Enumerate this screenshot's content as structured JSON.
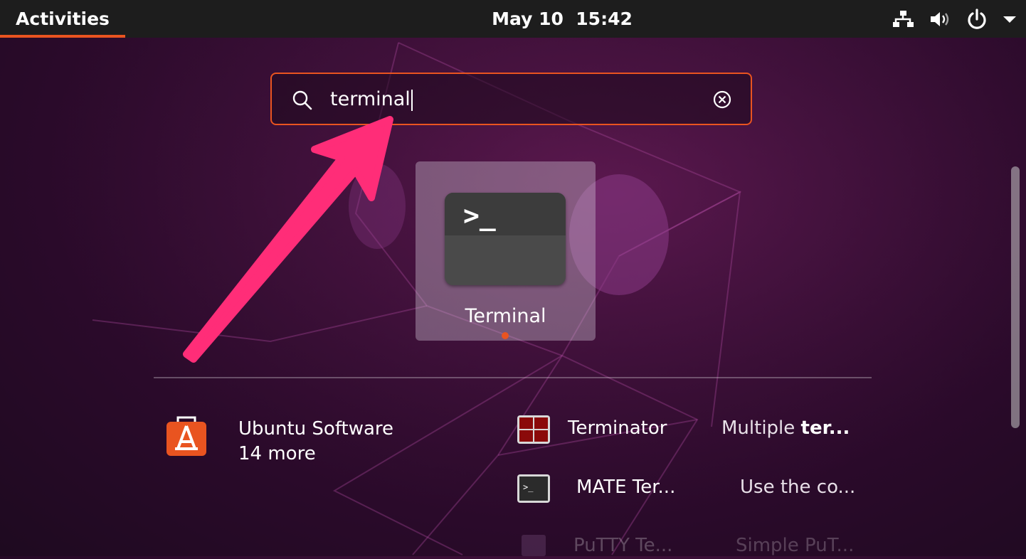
{
  "topbar": {
    "activities_label": "Activities",
    "clock": "May 10  15:42",
    "icons": [
      "network-icon",
      "volume-icon",
      "power-icon",
      "menu-arrow-icon"
    ]
  },
  "search": {
    "query": "terminal",
    "icons": [
      "search-icon",
      "clear-icon"
    ]
  },
  "apps": [
    {
      "label": "Terminal",
      "icon": "terminal-icon",
      "running": true
    }
  ],
  "provider": {
    "name": "Ubuntu Software",
    "more": "14 more",
    "icon": "ubuntu-software-icon"
  },
  "results": [
    {
      "name": "Terminator",
      "desc_plain": "Multiple ",
      "desc_bold": "ter...",
      "icon": "terminator-icon"
    },
    {
      "name": "MATE Ter...",
      "desc": "Use the co...",
      "icon": "mate-terminal-icon"
    },
    {
      "name": "PuTTY Te...",
      "desc": "Simple PuT...",
      "icon": "putty-icon"
    }
  ],
  "colors": {
    "accent": "#e95420",
    "topbar": "#1d1d1d",
    "annotation_arrow": "#ff2d78"
  }
}
